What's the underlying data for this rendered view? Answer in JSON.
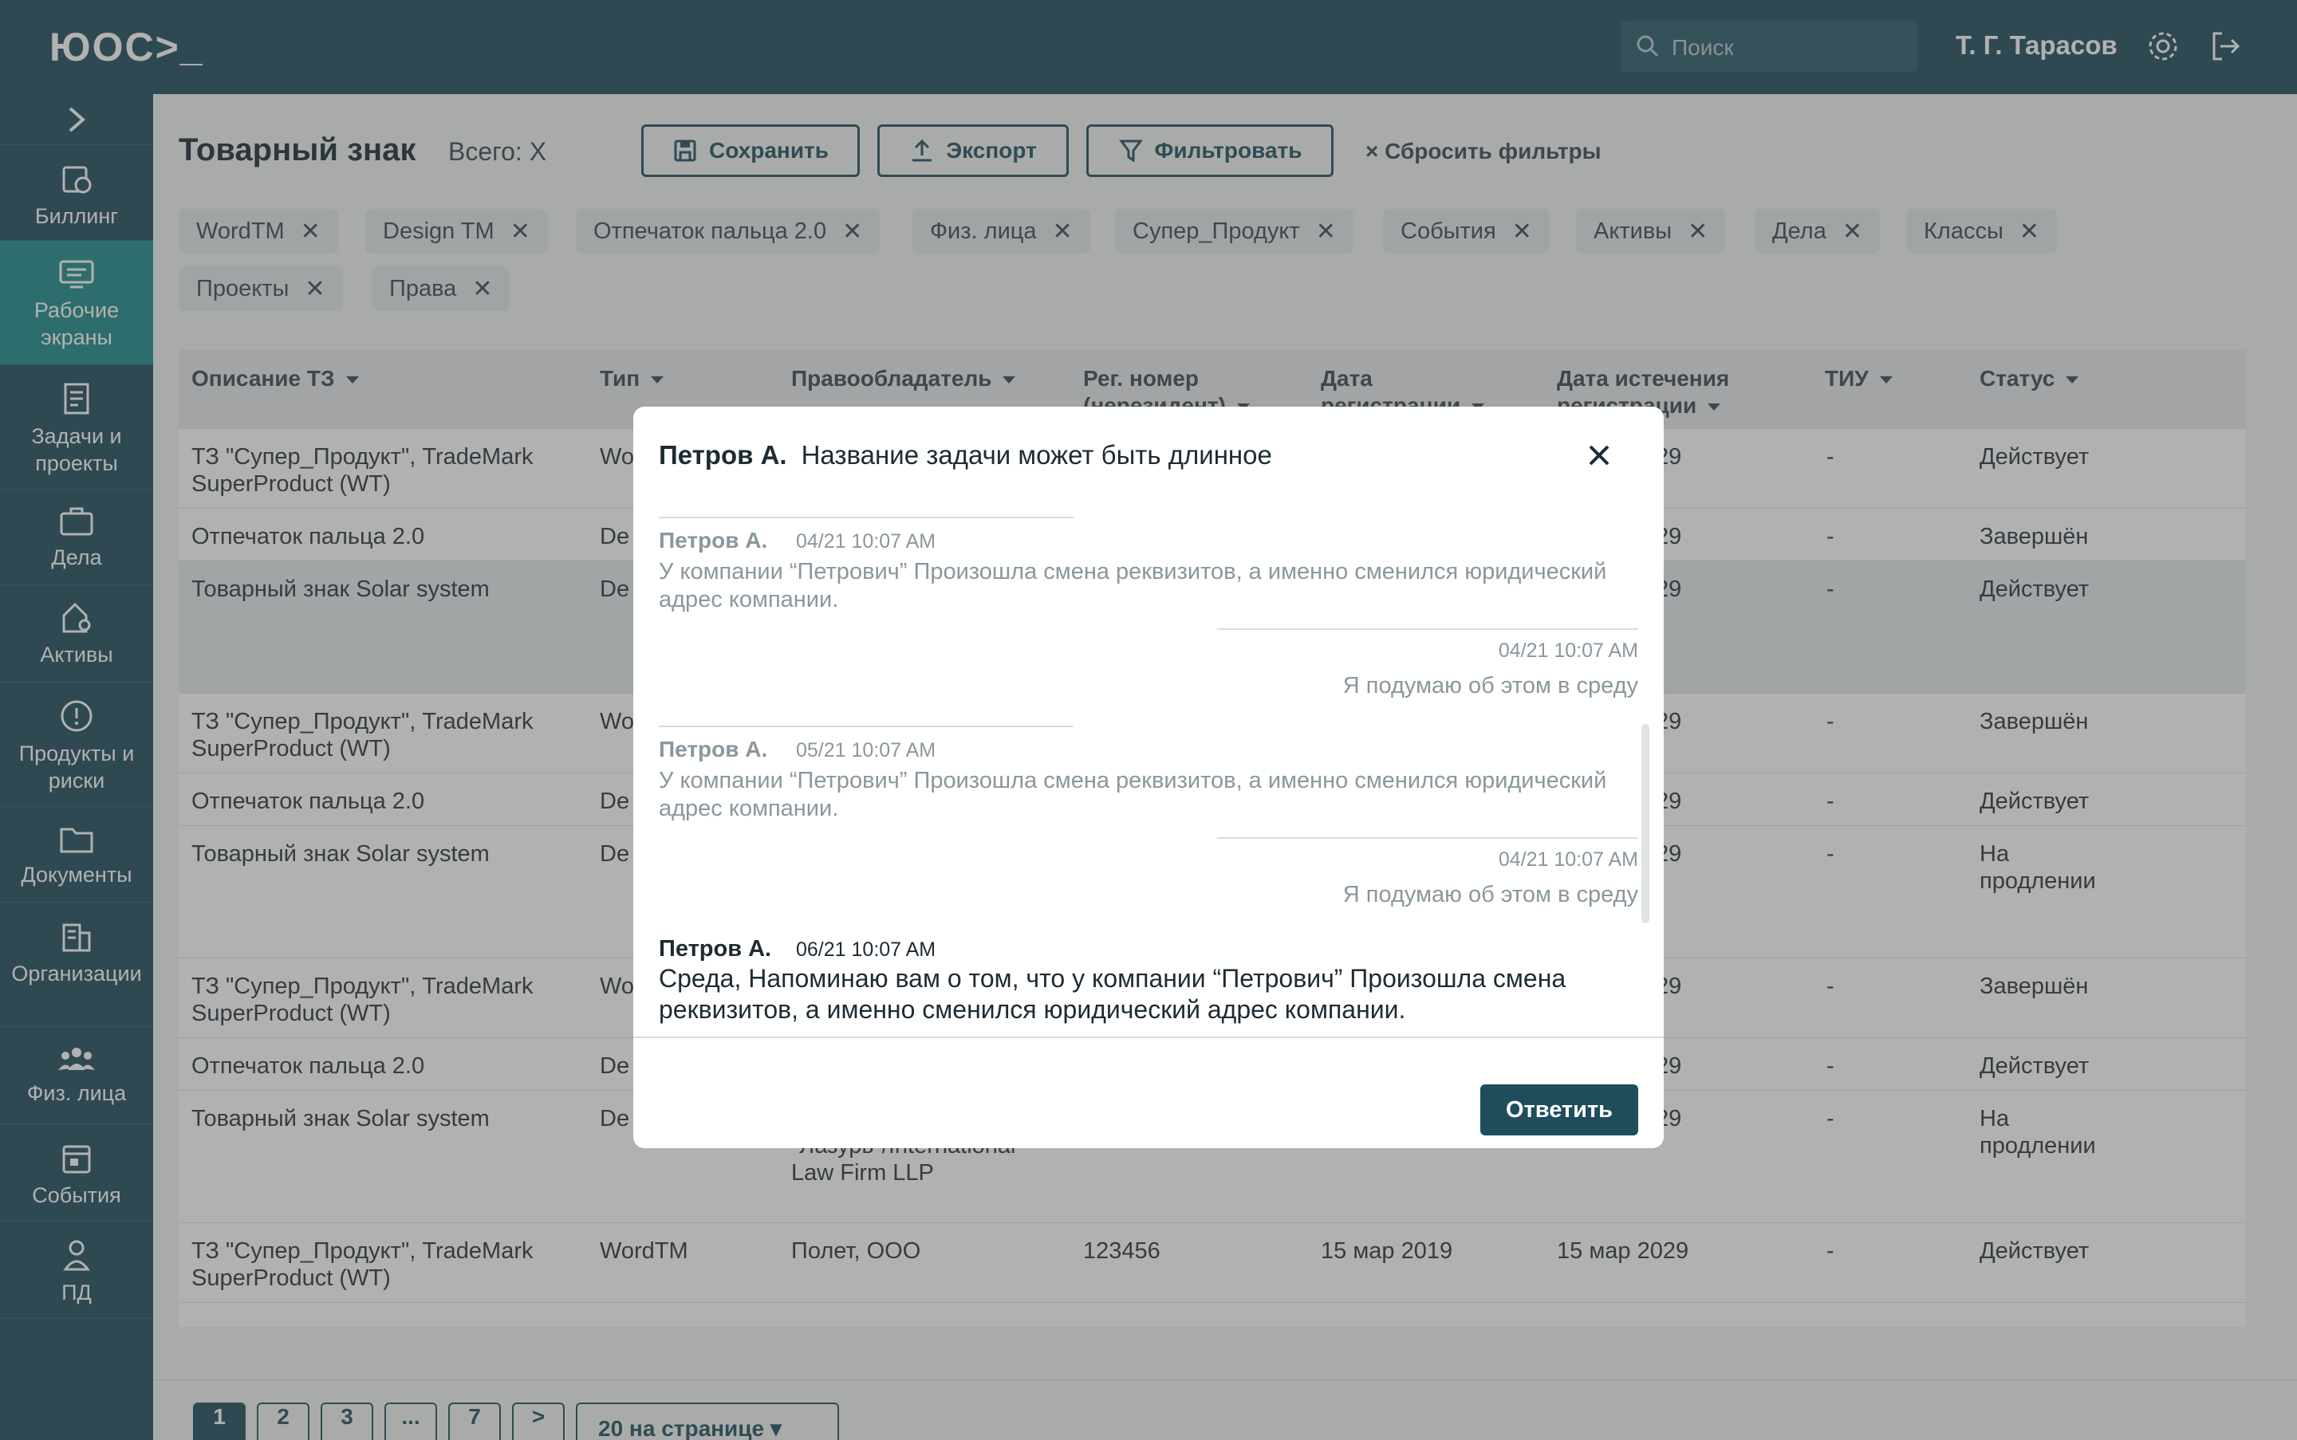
{
  "app": {
    "logo": "ЮОС>_",
    "search_placeholder": "Поиск",
    "user_name": "Т. Г. Тарасов"
  },
  "sidebar": {
    "items": [
      {
        "label": "Биллинг"
      },
      {
        "label": "Рабочие экраны"
      },
      {
        "label": "Задачи и проекты"
      },
      {
        "label": "Дела"
      },
      {
        "label": "Активы"
      },
      {
        "label": "Продукты и риски"
      },
      {
        "label": "Документы"
      },
      {
        "label": "Организации"
      },
      {
        "label": "Физ. лица"
      },
      {
        "label": "События"
      },
      {
        "label": "ПД"
      }
    ]
  },
  "page": {
    "title": "Товарный знак",
    "count": "Всего: X"
  },
  "toolbar": {
    "save": "Сохранить",
    "export": "Экспорт",
    "filter": "Фильтровать",
    "reset": "× Сбросить фильтры"
  },
  "chips": [
    "WordTM",
    "Design TM",
    "Отпечаток пальца 2.0",
    "Физ. лица",
    "Супер_Продукт",
    "События",
    "Активы",
    "Дела",
    "Классы",
    "Проекты",
    "Права"
  ],
  "table": {
    "columns": [
      "Описание ТЗ",
      "Тип",
      "Правообладатель",
      "Рег. номер (нерезидент)",
      "Дата регистрации",
      "Дата истечения регистрации",
      "ТИУ",
      "Статус"
    ],
    "rows": [
      {
        "desc": "ТЗ \"Супер_Продукт\", TradeMark SuperProduct (WT)",
        "type": "Wo",
        "owner": "",
        "reg": "",
        "date": "",
        "exp": "29",
        "tiu": "-",
        "status": "Действует"
      },
      {
        "desc": "Отпечаток пальца 2.0",
        "type": "De",
        "owner": "",
        "reg": "",
        "date": "",
        "exp": "29",
        "tiu": "-",
        "status": "Завершён"
      },
      {
        "desc": "Товарный знак Solar system",
        "type": "De",
        "owner": "",
        "reg": "",
        "date": "",
        "exp": "29",
        "tiu": "-",
        "status": "Действует"
      },
      {
        "desc": "ТЗ \"Супер_Продукт\", TradeMark SuperProduct (WT)",
        "type": "Wo",
        "owner": "",
        "reg": "",
        "date": "",
        "exp": "29",
        "tiu": "-",
        "status": "Завершён"
      },
      {
        "desc": "Отпечаток пальца 2.0",
        "type": "De",
        "owner": "",
        "reg": "",
        "date": "",
        "exp": "29",
        "tiu": "-",
        "status": "Действует"
      },
      {
        "desc": "Товарный знак Solar system",
        "type": "De",
        "owner": "",
        "reg": "",
        "date": "",
        "exp": "29",
        "tiu": "-",
        "status": "На продлении"
      },
      {
        "desc": "ТЗ \"Супер_Продукт\", TradeMark SuperProduct (WT)",
        "type": "Wo",
        "owner": "",
        "reg": "",
        "date": "",
        "exp": "29",
        "tiu": "-",
        "status": "Завершён"
      },
      {
        "desc": "Отпечаток пальца 2.0",
        "type": "De",
        "owner": "",
        "reg": "",
        "date": "",
        "exp": "29",
        "tiu": "-",
        "status": "Действует"
      },
      {
        "desc": "Товарный знак Solar system",
        "type": "De",
        "owner": "Юридическая фирма \"Лазурь\"/International Law Firm LLP",
        "reg": "",
        "date": "",
        "exp": "29",
        "tiu": "-",
        "status": "На продлении"
      },
      {
        "desc": "ТЗ \"Супер_Продукт\", TradeMark SuperProduct (WT)",
        "type": "WordTM",
        "owner": "Полет, ООО",
        "reg": "123456",
        "date": "15 мар 2019",
        "exp": "15 мар 2029",
        "tiu": "-",
        "status": "Действует"
      }
    ]
  },
  "pagination": {
    "pages": [
      "1",
      "2",
      "3",
      "...",
      "7",
      ">"
    ],
    "per_page": "20 на странице"
  },
  "modal": {
    "author": "Петров А.",
    "title": "Название задачи может быть длинное",
    "messages": [
      {
        "author": "Петров А.",
        "time": "04/21 10:07 AM",
        "text": "У компании “Петрович” Произошла смена реквизитов, а именно сменился юридический адрес компании."
      },
      {
        "time": "04/21  10:07 AM",
        "text": "Я подумаю об этом в среду"
      },
      {
        "author": "Петров А.",
        "time": "05/21 10:07 AM",
        "text": "У компании “Петрович” Произошла смена реквизитов, а именно сменился юридический адрес компании."
      },
      {
        "time": "04/21  10:07 AM",
        "text": "Я подумаю об этом в среду"
      },
      {
        "author": "Петров А.",
        "time": "06/21 10:07 AM",
        "text": "Среда, Напоминаю вам о том, что у компании “Петрович” Произошла смена реквизитов, а именно сменился юридический адрес компании."
      }
    ],
    "reply_label": "Ответить"
  },
  "colors": {
    "primary": "#1f4d5c",
    "active_nav": "#1d8a8a",
    "overlay": "rgba(70,70,70,0.42)"
  }
}
